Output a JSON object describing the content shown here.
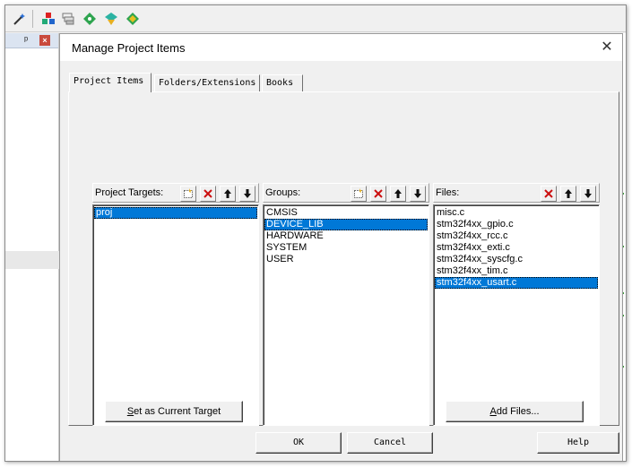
{
  "ide": {
    "toolbar_icons": [
      "wand-icon",
      "project-items-icon",
      "layers-icon",
      "component-icon",
      "pack-installer-icon",
      "select-packs-icon"
    ]
  },
  "dialog": {
    "title": "Manage Project Items",
    "close_glyph": "✕",
    "tabs": [
      {
        "label": "Project Items",
        "active": true
      },
      {
        "label": "Folders/Extensions",
        "active": false
      },
      {
        "label": "Books",
        "active": false
      }
    ],
    "targets": {
      "label": "Project Targets:",
      "items": [
        "proj"
      ],
      "selected_index": 0,
      "set_current_button": "Set as Current Target"
    },
    "groups": {
      "label": "Groups:",
      "items": [
        "CMSIS",
        "DEVICE_LIB",
        "HARDWARE",
        "SYSTEM",
        "USER"
      ],
      "selected_index": 1
    },
    "files": {
      "label": "Files:",
      "items": [
        "misc.c",
        "stm32f4xx_gpio.c",
        "stm32f4xx_rcc.c",
        "stm32f4xx_exti.c",
        "stm32f4xx_syscfg.c",
        "stm32f4xx_tim.c",
        "stm32f4xx_usart.c"
      ],
      "selected_index": 6,
      "add_files_button": "Add Files..."
    },
    "buttons": {
      "ok": "OK",
      "cancel": "Cancel",
      "help": "Help"
    }
  },
  "colors": {
    "selection": "#0078d7",
    "delete_red": "#cc1010"
  }
}
